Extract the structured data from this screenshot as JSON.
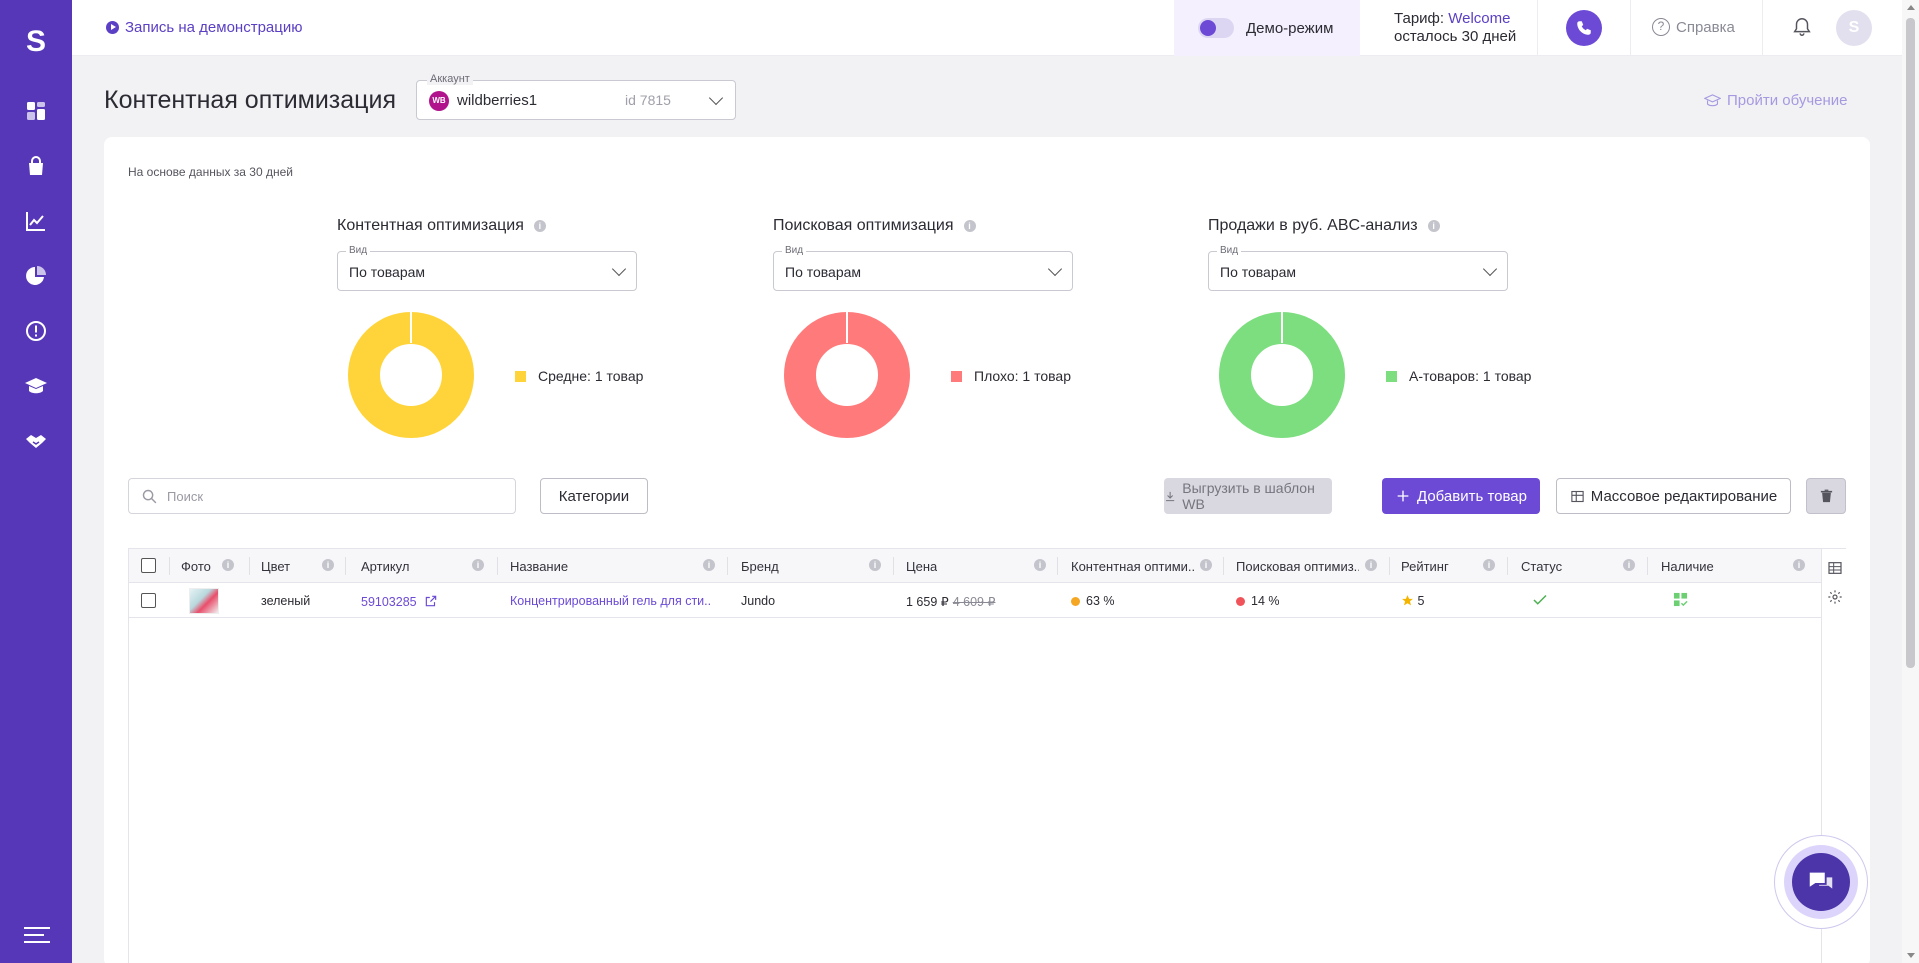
{
  "app": {
    "logo_letter": "S"
  },
  "sidebar": {
    "items": [
      {
        "icon": "dashboard-icon"
      },
      {
        "icon": "shopping-bag-icon"
      },
      {
        "icon": "chart-line-icon"
      },
      {
        "icon": "pie-chart-icon"
      },
      {
        "icon": "alert-circle-icon"
      },
      {
        "icon": "graduation-cap-icon"
      },
      {
        "icon": "handshake-icon"
      }
    ],
    "menu_icon": "hamburger-menu-icon"
  },
  "topbar": {
    "demo_link": "Запись на демонстрацию",
    "demo_mode": "Демо-режим",
    "tariff_label": "Тариф:",
    "tariff_name": "Welcome",
    "tariff_remaining": "осталось 30 дней",
    "help": "Справка",
    "avatar_letter": "S"
  },
  "header": {
    "title": "Контентная оптимизация",
    "account_label": "Аккаунт",
    "account_badge": "WB",
    "account_name": "wildberries1",
    "account_id": "id 7815",
    "training": "Пройти обучение"
  },
  "summary": {
    "based_on": "На основе данных за 30 дней",
    "view_label": "Вид",
    "charts": [
      {
        "title": "Контентная оптимизация",
        "view": "По товарам",
        "legend": "Средне: 1 товар",
        "color": "#ffd43b"
      },
      {
        "title": "Поисковая оптимизация",
        "view": "По товарам",
        "legend": "Плохо: 1 товар",
        "color": "#ff7b7b"
      },
      {
        "title": "Продажи в руб. ABC-анализ",
        "view": "По товарам",
        "legend": "А-товаров: 1 товар",
        "color": "#7dde80"
      }
    ]
  },
  "chart_data": [
    {
      "type": "pie",
      "title": "Контентная оптимизация",
      "categories": [
        "Средне"
      ],
      "values": [
        1
      ]
    },
    {
      "type": "pie",
      "title": "Поисковая оптимизация",
      "categories": [
        "Плохо"
      ],
      "values": [
        1
      ]
    },
    {
      "type": "pie",
      "title": "Продажи в руб. ABC-анализ",
      "categories": [
        "А-товаров"
      ],
      "values": [
        1
      ]
    }
  ],
  "toolbar": {
    "search_placeholder": "Поиск",
    "categories": "Категории",
    "export": "Выгрузить в шаблон WB",
    "add": "Добавить товар",
    "mass_edit": "Массовое редактирование"
  },
  "table": {
    "columns": [
      "Фото",
      "Цвет",
      "Артикул",
      "Название",
      "Бренд",
      "Цена",
      "Контентная оптими...",
      "Поисковая оптимиз...",
      "Рейтинг",
      "Статус",
      "Наличие"
    ],
    "rows": [
      {
        "color": "зеленый",
        "article": "59103285",
        "name": "Концентрированный гель для сти...",
        "brand": "Jundo",
        "price": "1 659 ₽",
        "old_price": "4 609 ₽",
        "content_opt": "63 %",
        "content_color": "#f5a623",
        "search_opt": "14 %",
        "search_color": "#f0545a",
        "rating": "5"
      }
    ]
  }
}
